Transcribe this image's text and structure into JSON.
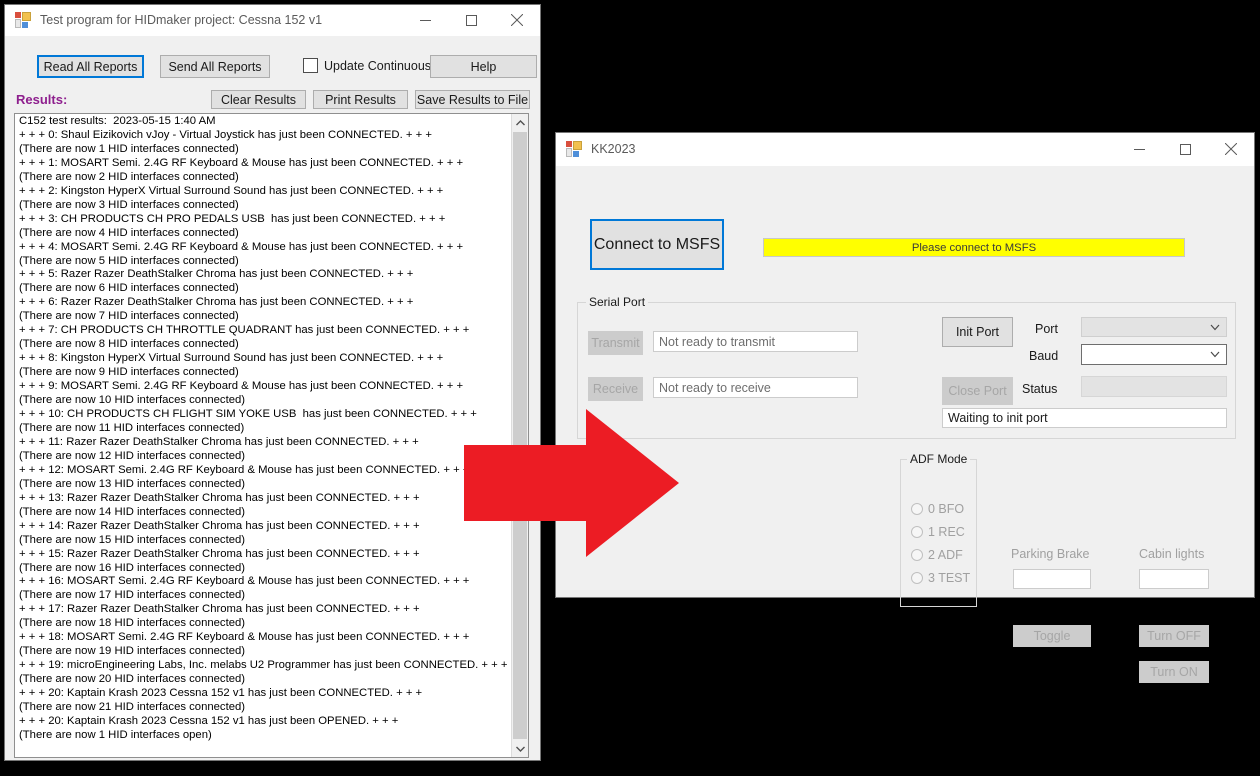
{
  "hidmaker_window": {
    "title": "Test program for HIDmaker project: Cessna 152 v1",
    "icon": "app-grid-icon",
    "window_buttons": {
      "minimize": "minimize-icon",
      "maximize": "maximize-icon",
      "close": "close-icon"
    },
    "toolbar": {
      "read_all_reports": "Read All Reports",
      "send_all_reports": "Send All Reports",
      "update_continuously": "Update Continuously",
      "help": "Help",
      "clear_results": "Clear Results",
      "print_results": "Print Results",
      "save_results_to_file": "Save Results to File",
      "update_continuously_checked": false
    },
    "results_label": "Results:",
    "results_label_color": "#8e1f8e",
    "results_lines": [
      "C152 test results:  2023-05-15 1:40 AM",
      "+ + + 0: Shaul Eizikovich vJoy - Virtual Joystick has just been CONNECTED. + + +",
      "(There are now 1 HID interfaces connected)",
      "+ + + 1: MOSART Semi. 2.4G RF Keyboard & Mouse has just been CONNECTED. + + +",
      "(There are now 2 HID interfaces connected)",
      "+ + + 2: Kingston HyperX Virtual Surround Sound has just been CONNECTED. + + +",
      "(There are now 3 HID interfaces connected)",
      "+ + + 3: CH PRODUCTS CH PRO PEDALS USB  has just been CONNECTED. + + +",
      "(There are now 4 HID interfaces connected)",
      "+ + + 4: MOSART Semi. 2.4G RF Keyboard & Mouse has just been CONNECTED. + + +",
      "(There are now 5 HID interfaces connected)",
      "+ + + 5: Razer Razer DeathStalker Chroma has just been CONNECTED. + + +",
      "(There are now 6 HID interfaces connected)",
      "+ + + 6: Razer Razer DeathStalker Chroma has just been CONNECTED. + + +",
      "(There are now 7 HID interfaces connected)",
      "+ + + 7: CH PRODUCTS CH THROTTLE QUADRANT has just been CONNECTED. + + +",
      "(There are now 8 HID interfaces connected)",
      "+ + + 8: Kingston HyperX Virtual Surround Sound has just been CONNECTED. + + +",
      "(There are now 9 HID interfaces connected)",
      "+ + + 9: MOSART Semi. 2.4G RF Keyboard & Mouse has just been CONNECTED. + + +",
      "(There are now 10 HID interfaces connected)",
      "+ + + 10: CH PRODUCTS CH FLIGHT SIM YOKE USB  has just been CONNECTED. + + +",
      "(There are now 11 HID interfaces connected)",
      "+ + + 11: Razer Razer DeathStalker Chroma has just been CONNECTED. + + +",
      "(There are now 12 HID interfaces connected)",
      "+ + + 12: MOSART Semi. 2.4G RF Keyboard & Mouse has just been CONNECTED. + + +",
      "(There are now 13 HID interfaces connected)",
      "+ + + 13: Razer Razer DeathStalker Chroma has just been CONNECTED. + + +",
      "(There are now 14 HID interfaces connected)",
      "+ + + 14: Razer Razer DeathStalker Chroma has just been CONNECTED. + + +",
      "(There are now 15 HID interfaces connected)",
      "+ + + 15: Razer Razer DeathStalker Chroma has just been CONNECTED. + + +",
      "(There are now 16 HID interfaces connected)",
      "+ + + 16: MOSART Semi. 2.4G RF Keyboard & Mouse has just been CONNECTED. + + +",
      "(There are now 17 HID interfaces connected)",
      "+ + + 17: Razer Razer DeathStalker Chroma has just been CONNECTED. + + +",
      "(There are now 18 HID interfaces connected)",
      "+ + + 18: MOSART Semi. 2.4G RF Keyboard & Mouse has just been CONNECTED. + + +",
      "(There are now 19 HID interfaces connected)",
      "+ + + 19: microEngineering Labs, Inc. melabs U2 Programmer has just been CONNECTED. + + +",
      "(There are now 20 HID interfaces connected)",
      "+ + + 20: Kaptain Krash 2023 Cessna 152 v1 has just been CONNECTED. + + +",
      "(There are now 21 HID interfaces connected)",
      "+ + + 20: Kaptain Krash 2023 Cessna 152 v1 has just been OPENED. + + +",
      "(There are now 1 HID interfaces open)"
    ],
    "scrollbar": {
      "up": "scroll-up-icon",
      "down": "scroll-down-icon"
    }
  },
  "kk_window": {
    "title": "KK2023",
    "icon": "app-grid-icon",
    "window_buttons": {
      "minimize": "minimize-icon",
      "maximize": "maximize-icon",
      "close": "close-icon"
    },
    "connect_button": "Connect to MSFS",
    "status_banner": {
      "text": "Please connect to MSFS",
      "background": "#ffff00"
    },
    "serial_port": {
      "group_title": "Serial Port",
      "transmit_button": "Transmit",
      "transmit_status": "Not ready to transmit",
      "receive_button": "Receive",
      "receive_status": "Not ready to receive",
      "init_port_button": "Init Port",
      "close_port_button": "Close Port",
      "port_label": "Port",
      "port_value": "",
      "baud_label": "Baud",
      "baud_value": "",
      "status_label": "Status",
      "status_value": "",
      "port_message": "Waiting to init port"
    },
    "adf_mode": {
      "group_title": "ADF Mode",
      "options": [
        "0 BFO",
        "1 REC",
        "2 ADF",
        "3 TEST"
      ],
      "selected": null
    },
    "parking_brake": {
      "label": "Parking Brake",
      "value": "",
      "toggle_button": "Toggle"
    },
    "cabin_lights": {
      "label": "Cabin lights",
      "value": "",
      "turn_off_button": "Turn OFF",
      "turn_on_button": "Turn ON"
    }
  },
  "annotation": {
    "arrow": {
      "name": "red-arrow-pointer",
      "color": "#ec1c24",
      "direction": "right"
    }
  }
}
